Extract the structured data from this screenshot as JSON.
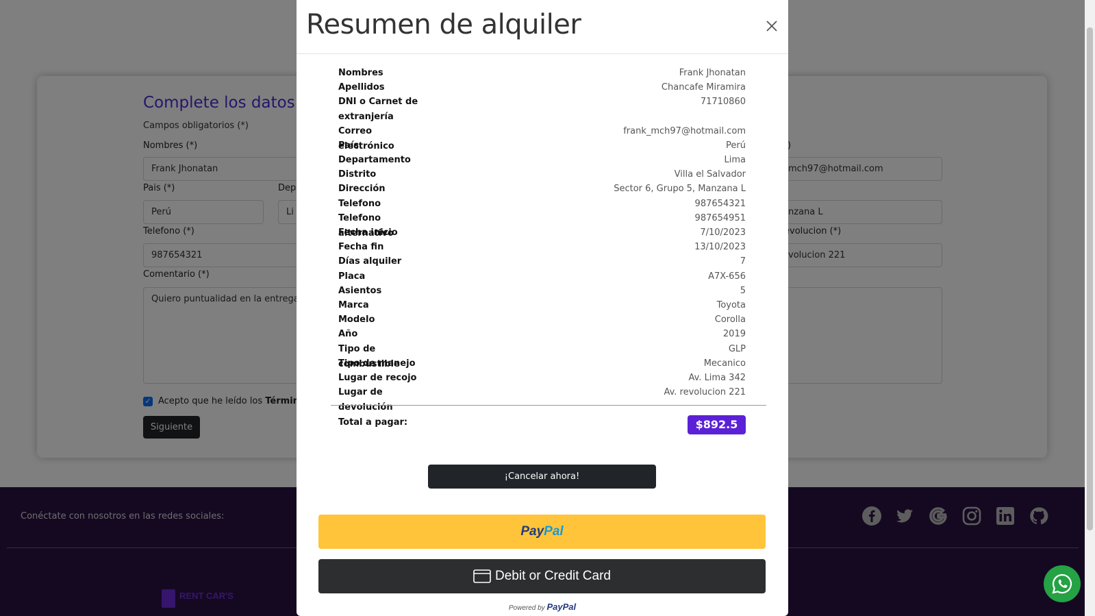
{
  "form": {
    "title": "Complete los datos:",
    "required_note": "Campos obligatorios (*)",
    "labels": {
      "nombres": "Nombres (*)",
      "pais": "Pais (*)",
      "departamento": "Dep",
      "telefono": "Telefono (*)",
      "comentario": "Comentario (*)",
      "correo_partial": ")",
      "devolucion_partial": "evolucion (*)"
    },
    "values": {
      "nombres": "Frank Jhonatan",
      "pais": "Perú",
      "departamento": "Li",
      "telefono": "987654321",
      "comentario": "Quiero puntualidad en la entrega",
      "correo_partial": "mch97@hotmail.com",
      "direccion_partial": "nzana L",
      "devolucion_partial": "volucion 221"
    },
    "terms_label_prefix": "Acepto que he leído los ",
    "terms_label_bold": "Términ",
    "next_button": "Siguiente"
  },
  "footer": {
    "social_text": "Conéctate con nosotros en las redes sociales:",
    "social_icons": [
      "facebook-icon",
      "twitter-icon",
      "google-icon",
      "instagram-icon",
      "linkedin-icon",
      "github-icon"
    ],
    "brand": "RENT CAR'S"
  },
  "modal": {
    "title": "Resumen de alquiler",
    "rows": [
      {
        "key": "Nombres",
        "value": "Frank Jhonatan"
      },
      {
        "key": "Apellidos",
        "value": "Chancafe Miramira"
      },
      {
        "key": "DNI o Carnet de extranjería",
        "value": "71710860"
      },
      {
        "key": "Correo electrónico",
        "value": "frank_mch97@hotmail.com"
      },
      {
        "key": "País",
        "value": "Perú"
      },
      {
        "key": "Departamento",
        "value": "Lima"
      },
      {
        "key": "Distrito",
        "value": "Villa el Salvador"
      },
      {
        "key": "Dirección",
        "value": "Sector 6, Grupo 5, Manzana L"
      },
      {
        "key": "Telefono",
        "value": "987654321"
      },
      {
        "key": "Telefono alternativo",
        "value": "987654951"
      },
      {
        "key": "Fecha inicio",
        "value": "7/10/2023"
      },
      {
        "key": "Fecha fin",
        "value": "13/10/2023"
      },
      {
        "key": "Días alquiler",
        "value": "7"
      },
      {
        "key": "Placa",
        "value": "A7X-656"
      },
      {
        "key": "Asientos",
        "value": "5"
      },
      {
        "key": "Marca",
        "value": "Toyota"
      },
      {
        "key": "Modelo",
        "value": "Corolla"
      },
      {
        "key": "Año",
        "value": "2019"
      },
      {
        "key": "Tipo de combustible",
        "value": "GLP"
      },
      {
        "key": "Tipo de manejo",
        "value": "Mecanico"
      },
      {
        "key": "Lugar de recojo",
        "value": "Av. Lima 342"
      },
      {
        "key": "Lugar de devolución",
        "value": "Av. revolucion 221"
      }
    ],
    "total_label": "Total a pagar:",
    "total_value": "$892.5",
    "cancel_button": "¡Cancelar ahora!",
    "paypal_button": {
      "part1": "Pay",
      "part2": "Pal"
    },
    "card_button": "Debit or Credit Card",
    "powered_by": "Powered by",
    "powered_brand": "PayPal"
  },
  "colors": {
    "accent": "#5b21d6",
    "paypal_yellow": "#ffc439",
    "dark_button": "#212529",
    "footer_bg": "#2a1245",
    "whatsapp": "#25a244"
  }
}
